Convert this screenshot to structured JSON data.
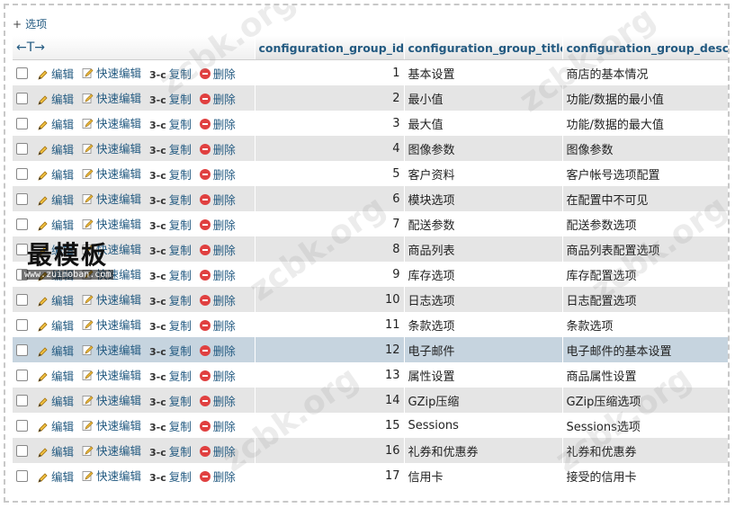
{
  "options_label": "选项",
  "sort_glyph": "←T→",
  "columns": [
    {
      "label": ""
    },
    {
      "label": "configuration_group_id"
    },
    {
      "label": "configuration_group_title"
    },
    {
      "label": "configuration_group_descr"
    }
  ],
  "actions": {
    "edit": "编辑",
    "quick_edit": "快速编辑",
    "copy": "复制",
    "delete": "删除"
  },
  "rows": [
    {
      "id": "1",
      "title": "基本设置",
      "desc": "商店的基本情况"
    },
    {
      "id": "2",
      "title": "最小值",
      "desc": "功能/数据的最小值"
    },
    {
      "id": "3",
      "title": "最大值",
      "desc": "功能/数据的最大值"
    },
    {
      "id": "4",
      "title": "图像参数",
      "desc": "图像参数"
    },
    {
      "id": "5",
      "title": "客户资料",
      "desc": "客户帐号选项配置"
    },
    {
      "id": "6",
      "title": "模块选项",
      "desc": "在配置中不可见"
    },
    {
      "id": "7",
      "title": "配送参数",
      "desc": "配送参数选项"
    },
    {
      "id": "8",
      "title": "商品列表",
      "desc": "商品列表配置选项"
    },
    {
      "id": "9",
      "title": "库存选项",
      "desc": "库存配置选项"
    },
    {
      "id": "10",
      "title": "日志选项",
      "desc": "日志配置选项"
    },
    {
      "id": "11",
      "title": "条款选项",
      "desc": "条款选项"
    },
    {
      "id": "12",
      "title": "电子邮件",
      "desc": "电子邮件的基本设置"
    },
    {
      "id": "13",
      "title": "属性设置",
      "desc": "商品属性设置"
    },
    {
      "id": "14",
      "title": "GZip压缩",
      "desc": "GZip压缩选项"
    },
    {
      "id": "15",
      "title": "Sessions",
      "desc": "Sessions选项"
    },
    {
      "id": "16",
      "title": "礼券和优惠券",
      "desc": "礼券和优惠券"
    },
    {
      "id": "17",
      "title": "信用卡",
      "desc": "接受的信用卡"
    }
  ],
  "highlight_row_id": "12",
  "watermark": {
    "main": "最模板",
    "sub": "www.zuimoban.com",
    "faint": "zcbk.org"
  },
  "colors": {
    "link": "#235a81",
    "row_even": "#e5e5e5",
    "row_highlight": "#c6d4df",
    "delete": "#e04040"
  }
}
